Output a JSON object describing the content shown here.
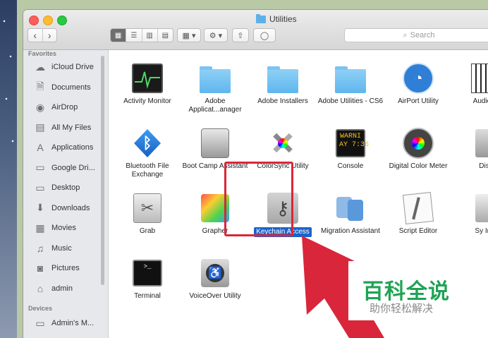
{
  "window": {
    "title": "Utilities"
  },
  "toolbar": {
    "back": "‹",
    "forward": "›",
    "views": [
      "▦",
      "☰",
      "▥",
      "▤"
    ],
    "arrange": "▦ ▾",
    "action": "⚙ ▾",
    "share": "⇧",
    "tag": "◯",
    "search_placeholder": "Search"
  },
  "sidebar": {
    "favorites_header": "Favorites",
    "devices_header": "Devices",
    "favorites": [
      {
        "label": "iCloud Drive",
        "icon": "☁"
      },
      {
        "label": "Documents",
        "icon": "🗎"
      },
      {
        "label": "AirDrop",
        "icon": "◉"
      },
      {
        "label": "All My Files",
        "icon": "▤"
      },
      {
        "label": "Applications",
        "icon": "A"
      },
      {
        "label": "Google Dri...",
        "icon": "▭"
      },
      {
        "label": "Desktop",
        "icon": "▭"
      },
      {
        "label": "Downloads",
        "icon": "⬇"
      },
      {
        "label": "Movies",
        "icon": "▦"
      },
      {
        "label": "Music",
        "icon": "♫"
      },
      {
        "label": "Pictures",
        "icon": "◙"
      },
      {
        "label": "admin",
        "icon": "⌂"
      }
    ],
    "devices": [
      {
        "label": "Admin's M...",
        "icon": "▭"
      }
    ]
  },
  "apps": [
    {
      "label": "Activity Monitor",
      "icon": "activity-monitor-icon"
    },
    {
      "label": "Adobe Applicat...anager",
      "icon": "folder-icon"
    },
    {
      "label": "Adobe Installers",
      "icon": "folder-icon"
    },
    {
      "label": "Adobe Utilities - CS6",
      "icon": "folder-icon"
    },
    {
      "label": "AirPort Utility",
      "icon": "airport-utility-icon"
    },
    {
      "label": "Audio M",
      "icon": "audio-midi-icon"
    },
    {
      "label": "Bluetooth File Exchange",
      "icon": "bluetooth-icon"
    },
    {
      "label": "Boot Camp Assistant",
      "icon": "boot-camp-icon"
    },
    {
      "label": "ColorSync Utility",
      "icon": "colorsync-icon"
    },
    {
      "label": "Console",
      "icon": "console-icon"
    },
    {
      "label": "Digital Color Meter",
      "icon": "digital-color-meter-icon"
    },
    {
      "label": "Disk",
      "icon": "disk-utility-icon"
    },
    {
      "label": "Grab",
      "icon": "grab-icon"
    },
    {
      "label": "Grapher",
      "icon": "grapher-icon"
    },
    {
      "label": "Keychain Access",
      "icon": "keychain-icon"
    },
    {
      "label": "Migration Assistant",
      "icon": "migration-icon"
    },
    {
      "label": "Script Editor",
      "icon": "script-editor-icon"
    },
    {
      "label": "Sy Info",
      "icon": "system-info-icon"
    },
    {
      "label": "Terminal",
      "icon": "terminal-icon"
    },
    {
      "label": "VoiceOver Utility",
      "icon": "voiceover-icon"
    }
  ],
  "console_text": "WARNI\nAY 7:36",
  "watermark": {
    "title": "百科全说",
    "subtitle": "助你轻松解决"
  }
}
